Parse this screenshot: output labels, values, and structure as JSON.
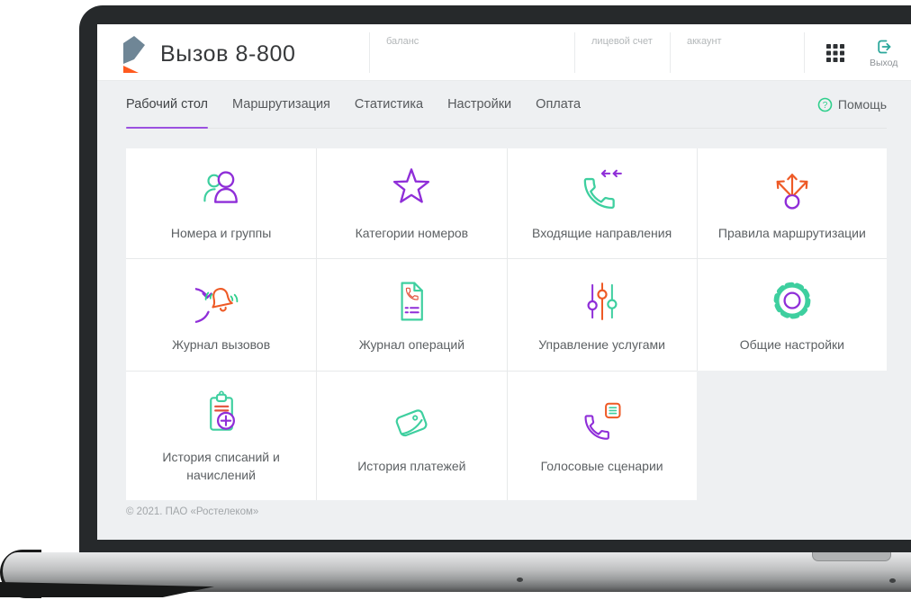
{
  "header": {
    "app_title": "Вызов 8-800",
    "fields": [
      {
        "label": "баланс",
        "value": ""
      },
      {
        "label": "лицевой счет",
        "value": ""
      },
      {
        "label": "аккаунт",
        "value": ""
      }
    ],
    "apps_grid_icon": "apps-grid-icon",
    "logout_label": "Выход",
    "logout_icon": "logout-icon"
  },
  "nav": {
    "tabs": [
      {
        "label": "Рабочий стол",
        "active": true
      },
      {
        "label": "Маршрутизация",
        "active": false
      },
      {
        "label": "Статистика",
        "active": false
      },
      {
        "label": "Настройки",
        "active": false
      },
      {
        "label": "Оплата",
        "active": false
      }
    ],
    "help_label": "Помощь",
    "help_icon": "question-circle-icon"
  },
  "tiles": [
    {
      "label": "Номера и группы",
      "icon": "people-icon"
    },
    {
      "label": "Категории номеров",
      "icon": "star-icon"
    },
    {
      "label": "Входящие направления",
      "icon": "incoming-call-icon"
    },
    {
      "label": "Правила маршрутизации",
      "icon": "routing-arrows-icon"
    },
    {
      "label": "Журнал вызовов",
      "icon": "call-log-bell-icon"
    },
    {
      "label": "Журнал операций",
      "icon": "operations-document-icon"
    },
    {
      "label": "Управление услугами",
      "icon": "services-sliders-icon"
    },
    {
      "label": "Общие настройки",
      "icon": "settings-gear-icon"
    },
    {
      "label": "История списаний и начислений",
      "icon": "charges-history-clipboard-icon"
    },
    {
      "label": "История платежей",
      "icon": "payments-wallet-icon"
    },
    {
      "label": "Голосовые сценарии",
      "icon": "voice-scenarios-phone-icon"
    }
  ],
  "footer": {
    "copyright": "© 2021. ПАО «Ростелеком»"
  },
  "colors": {
    "purple": "#8f2ed8",
    "purple_underline": "#9b51e0",
    "mint": "#3ecf9f",
    "orange": "#ee5a26",
    "green": "#2fcf8c",
    "teal": "#2aa79b",
    "redline": "#e2503b",
    "logo_gray": "#6f8696",
    "logo_orange": "#ff5a1f"
  }
}
